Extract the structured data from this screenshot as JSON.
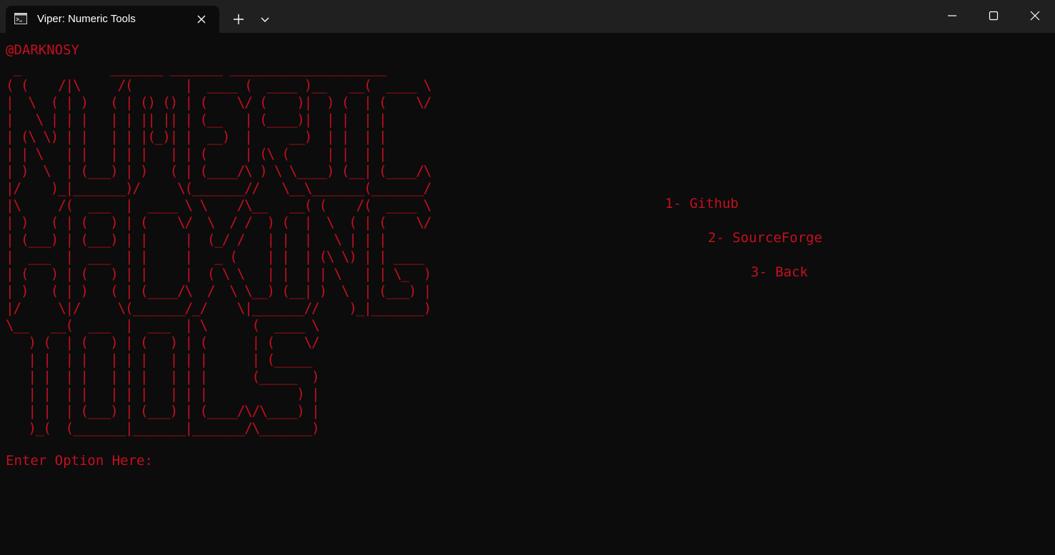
{
  "window": {
    "tab_title": "Viper: Numeric Tools",
    "tab_icon": "terminal-icon",
    "controls": [
      "minimize-icon",
      "maximize-icon",
      "close-icon"
    ]
  },
  "terminal": {
    "handle": "@DARKNOSY",
    "banner": " _            _______ _______ _____________________\n( (    /|\\     /(       |  ____ (  ____ )__   __(  ____ \\\n|  \\  ( | )   ( | () () | (    \\/ (    )|  ) (  | (    \\/\n|   \\ | | |   | | || || | (__   | (____)|  | |  | |\n| (\\ \\) | |   | | |(_)| |  __)  |     __)  | |  | |\n| | \\   | |   | | |   | | (     | (\\ (     | |  | |\n| )  \\  | (___) | )   ( | (____/\\ ) \\ \\____) (__| (____/\\\n|/    )_|_______)/     \\(_______//   \\__\\_______(_______/\n|\\     /(  ___  |  ____ \\ \\    /\\__   __( (    /(  ____ \\\n| )   ( | (   ) | (    \\/  \\  / /  ) (  |  \\  ( | (    \\/\n| (___) | (___) | |     |  (_/ /   | |  |   \\ | | |\n|  ___  |  ___  | |     |   _ (    | |  | (\\ \\) | | ____\n| (   ) | (   ) | |     |  ( \\ \\   | |  | | \\   | | \\_  )\n| )   ( | )   ( | (____/\\  /  \\ \\__) (__| )  \\  | (___) |\n|/     \\|/     \\(_______/_/    \\|_______//    )_|_______)\n\\__   __(  ___  |  ___  | \\      (  ____ \\\n   ) (  | (   ) | (   ) | (      | (    \\/\n   | |  | |   | | |   | | |      | (_____\n   | |  | |   | | |   | | |      (_____  )\n   | |  | |   | | |   | | |            ) |\n   | |  | (___) | (___) | (____/\\/\\____) |\n   )_(  (_______|_______|_______/\\_______)",
    "menu": [
      {
        "label": "1- Github"
      },
      {
        "label": "2- SourceForge"
      },
      {
        "label": "3- Back"
      }
    ],
    "prompt": "Enter Option Here:",
    "input_value": "",
    "text_color": "#c50f1f",
    "background_color": "#0c0c0c"
  }
}
